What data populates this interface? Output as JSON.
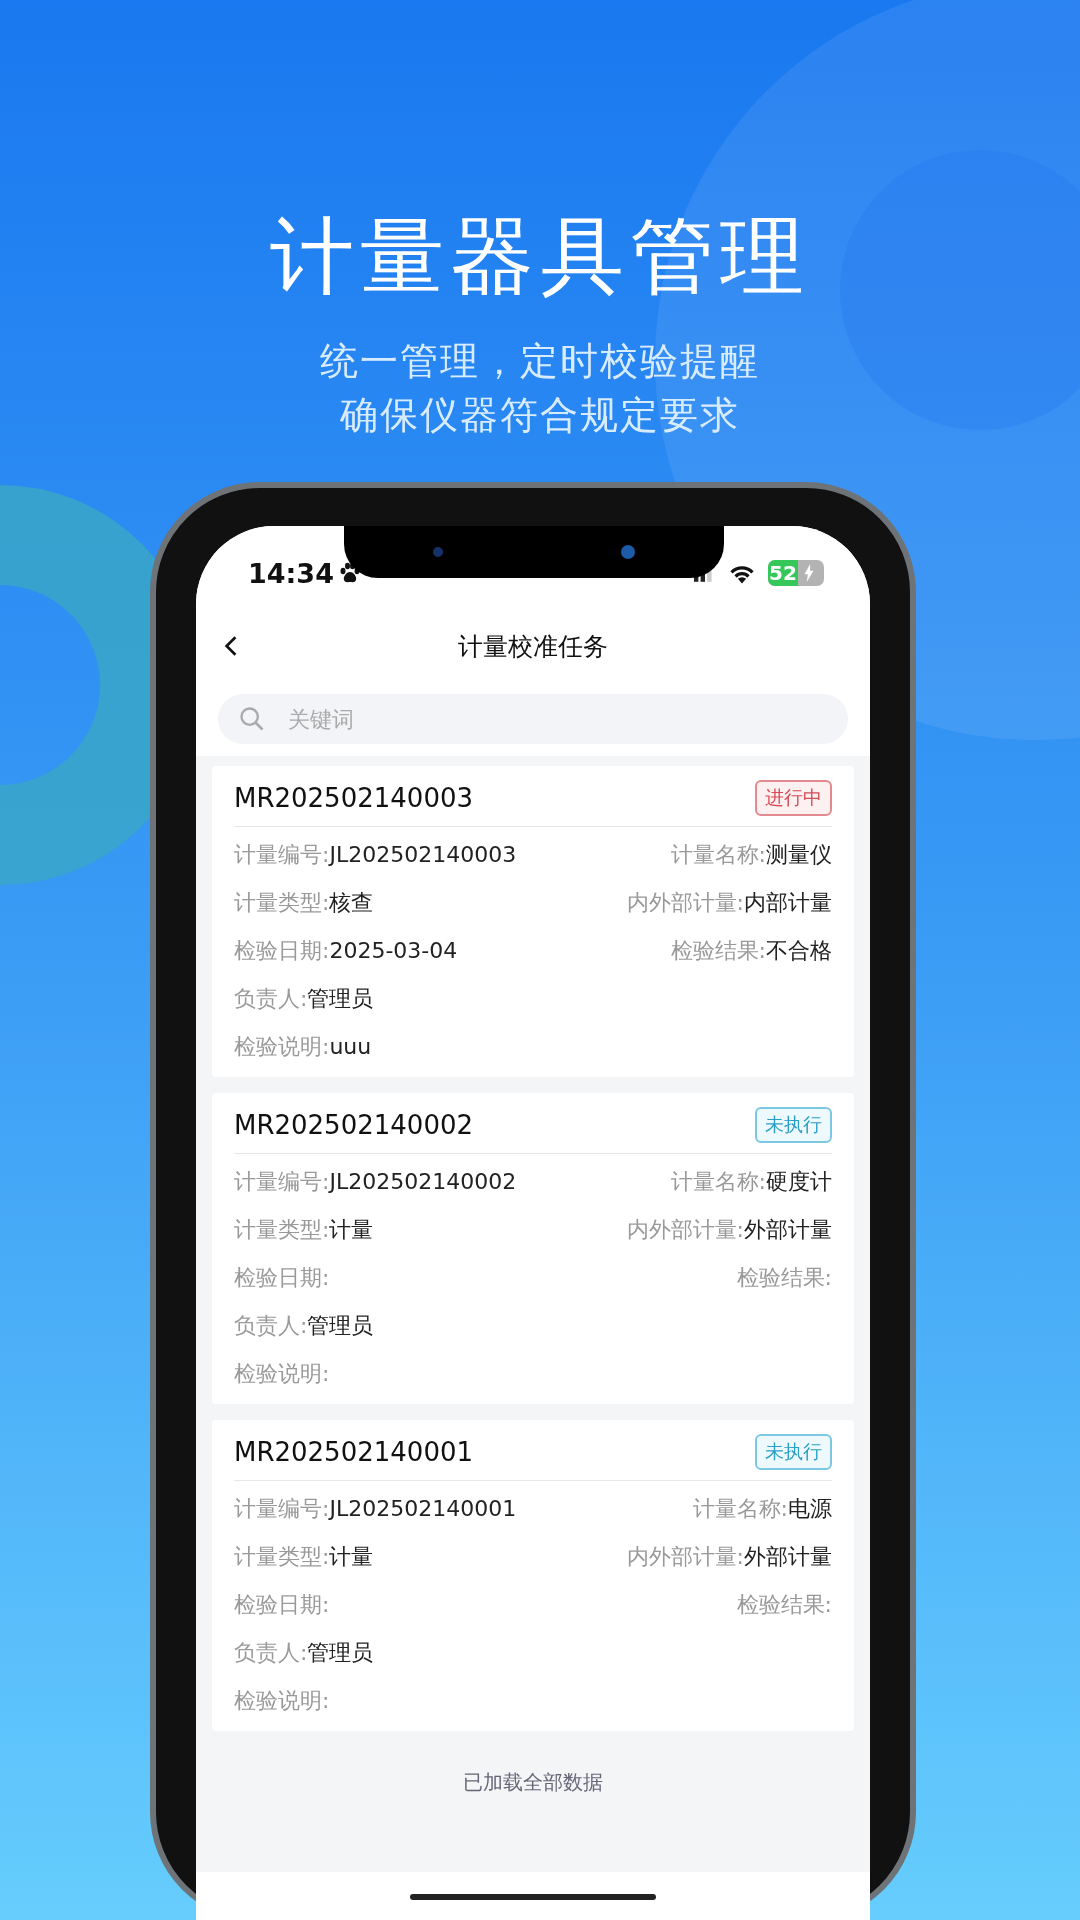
{
  "headline": "计量器具管理",
  "subtitle": [
    "统一管理，定时校验提醒",
    "确保仪器符合规定要求"
  ],
  "status_bar": {
    "time": "14:34",
    "battery": "52"
  },
  "nav": {
    "title": "计量校准任务"
  },
  "search": {
    "placeholder": "关键词"
  },
  "cards": [
    {
      "code": "MR202502140003",
      "status": {
        "label": "进行中",
        "kind": "in_progress"
      },
      "rows": [
        {
          "left": {
            "label": "计量编号:",
            "value": "JL202502140003"
          },
          "right": {
            "label": "计量名称:",
            "value": "测量仪"
          }
        },
        {
          "left": {
            "label": "计量类型:",
            "value": "核查"
          },
          "right": {
            "label": "内外部计量:",
            "value": "内部计量"
          }
        },
        {
          "left": {
            "label": "检验日期:",
            "value": "2025-03-04"
          },
          "right": {
            "label": "检验结果:",
            "value": "不合格"
          }
        },
        {
          "left": {
            "label": "负责人:",
            "value": "管理员"
          }
        },
        {
          "left": {
            "label": "检验说明:",
            "value": "uuu"
          }
        }
      ]
    },
    {
      "code": "MR202502140002",
      "status": {
        "label": "未执行",
        "kind": "pending"
      },
      "rows": [
        {
          "left": {
            "label": "计量编号:",
            "value": "JL202502140002"
          },
          "right": {
            "label": "计量名称:",
            "value": "硬度计"
          }
        },
        {
          "left": {
            "label": "计量类型:",
            "value": "计量"
          },
          "right": {
            "label": "内外部计量:",
            "value": "外部计量"
          }
        },
        {
          "left": {
            "label": "检验日期:"
          },
          "right": {
            "label": "检验结果:"
          }
        },
        {
          "left": {
            "label": "负责人:",
            "value": "管理员"
          }
        },
        {
          "left": {
            "label": "检验说明:"
          }
        }
      ]
    },
    {
      "code": "MR202502140001",
      "status": {
        "label": "未执行",
        "kind": "pending"
      },
      "rows": [
        {
          "left": {
            "label": "计量编号:",
            "value": "JL202502140001"
          },
          "right": {
            "label": "计量名称:",
            "value": "电源"
          }
        },
        {
          "left": {
            "label": "计量类型:",
            "value": "计量"
          },
          "right": {
            "label": "内外部计量:",
            "value": "外部计量"
          }
        },
        {
          "left": {
            "label": "检验日期:"
          },
          "right": {
            "label": "检验结果:"
          }
        },
        {
          "left": {
            "label": "负责人:",
            "value": "管理员"
          }
        },
        {
          "left": {
            "label": "检验说明:"
          }
        }
      ]
    }
  ],
  "footer": "已加载全部数据"
}
